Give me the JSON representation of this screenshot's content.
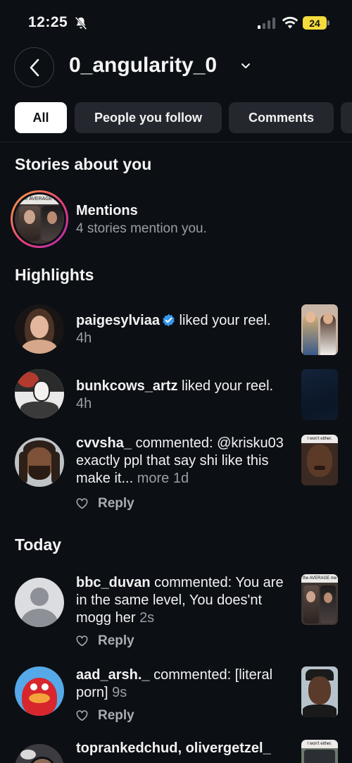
{
  "status_bar": {
    "time": "12:25",
    "battery": "24"
  },
  "header": {
    "username": "0_angularity_0"
  },
  "filters": {
    "all": "All",
    "people_you_follow": "People you follow",
    "comments": "Comments"
  },
  "stories_section": {
    "title": "Stories about you",
    "mentions_title": "Mentions",
    "mentions_subtitle": "4 stories mention you.",
    "thumb_caption": "the AVERAGE m"
  },
  "highlights": {
    "title": "Highlights",
    "items": [
      {
        "user": "paigesylviaa",
        "verified": true,
        "action": " liked your reel.",
        "time": "4h"
      },
      {
        "user": "bunkcows_artz",
        "action": " liked your reel.",
        "time": "4h"
      },
      {
        "user": "cvvsha_",
        "action": " commented: @krisku03 exactly ppl that say shi like this make it...",
        "more": "more",
        "time": "1d",
        "reply": "Reply"
      }
    ]
  },
  "today": {
    "title": "Today",
    "items": [
      {
        "user": "bbc_duvan",
        "action": " commented: You are in the same level, You does'nt mogg her",
        "time": "2s",
        "reply": "Reply",
        "thumb_caption": "the AVERAGE me"
      },
      {
        "user": "aad_arsh._",
        "action": " commented: [literal porn]",
        "time": "9s",
        "reply": "Reply"
      },
      {
        "user": "toprankedchud, olivergetzel_",
        "thumb_caption": "I won't either."
      }
    ]
  },
  "cvvsha_thumb_caption": "I won't either.",
  "colors": {
    "background": "#0c0f14",
    "chip": "#24272e",
    "verified": "#3797f0",
    "meta": "#9a9ea6",
    "story_ring_start": "#f58529",
    "story_ring_end": "#dd2a7b"
  }
}
